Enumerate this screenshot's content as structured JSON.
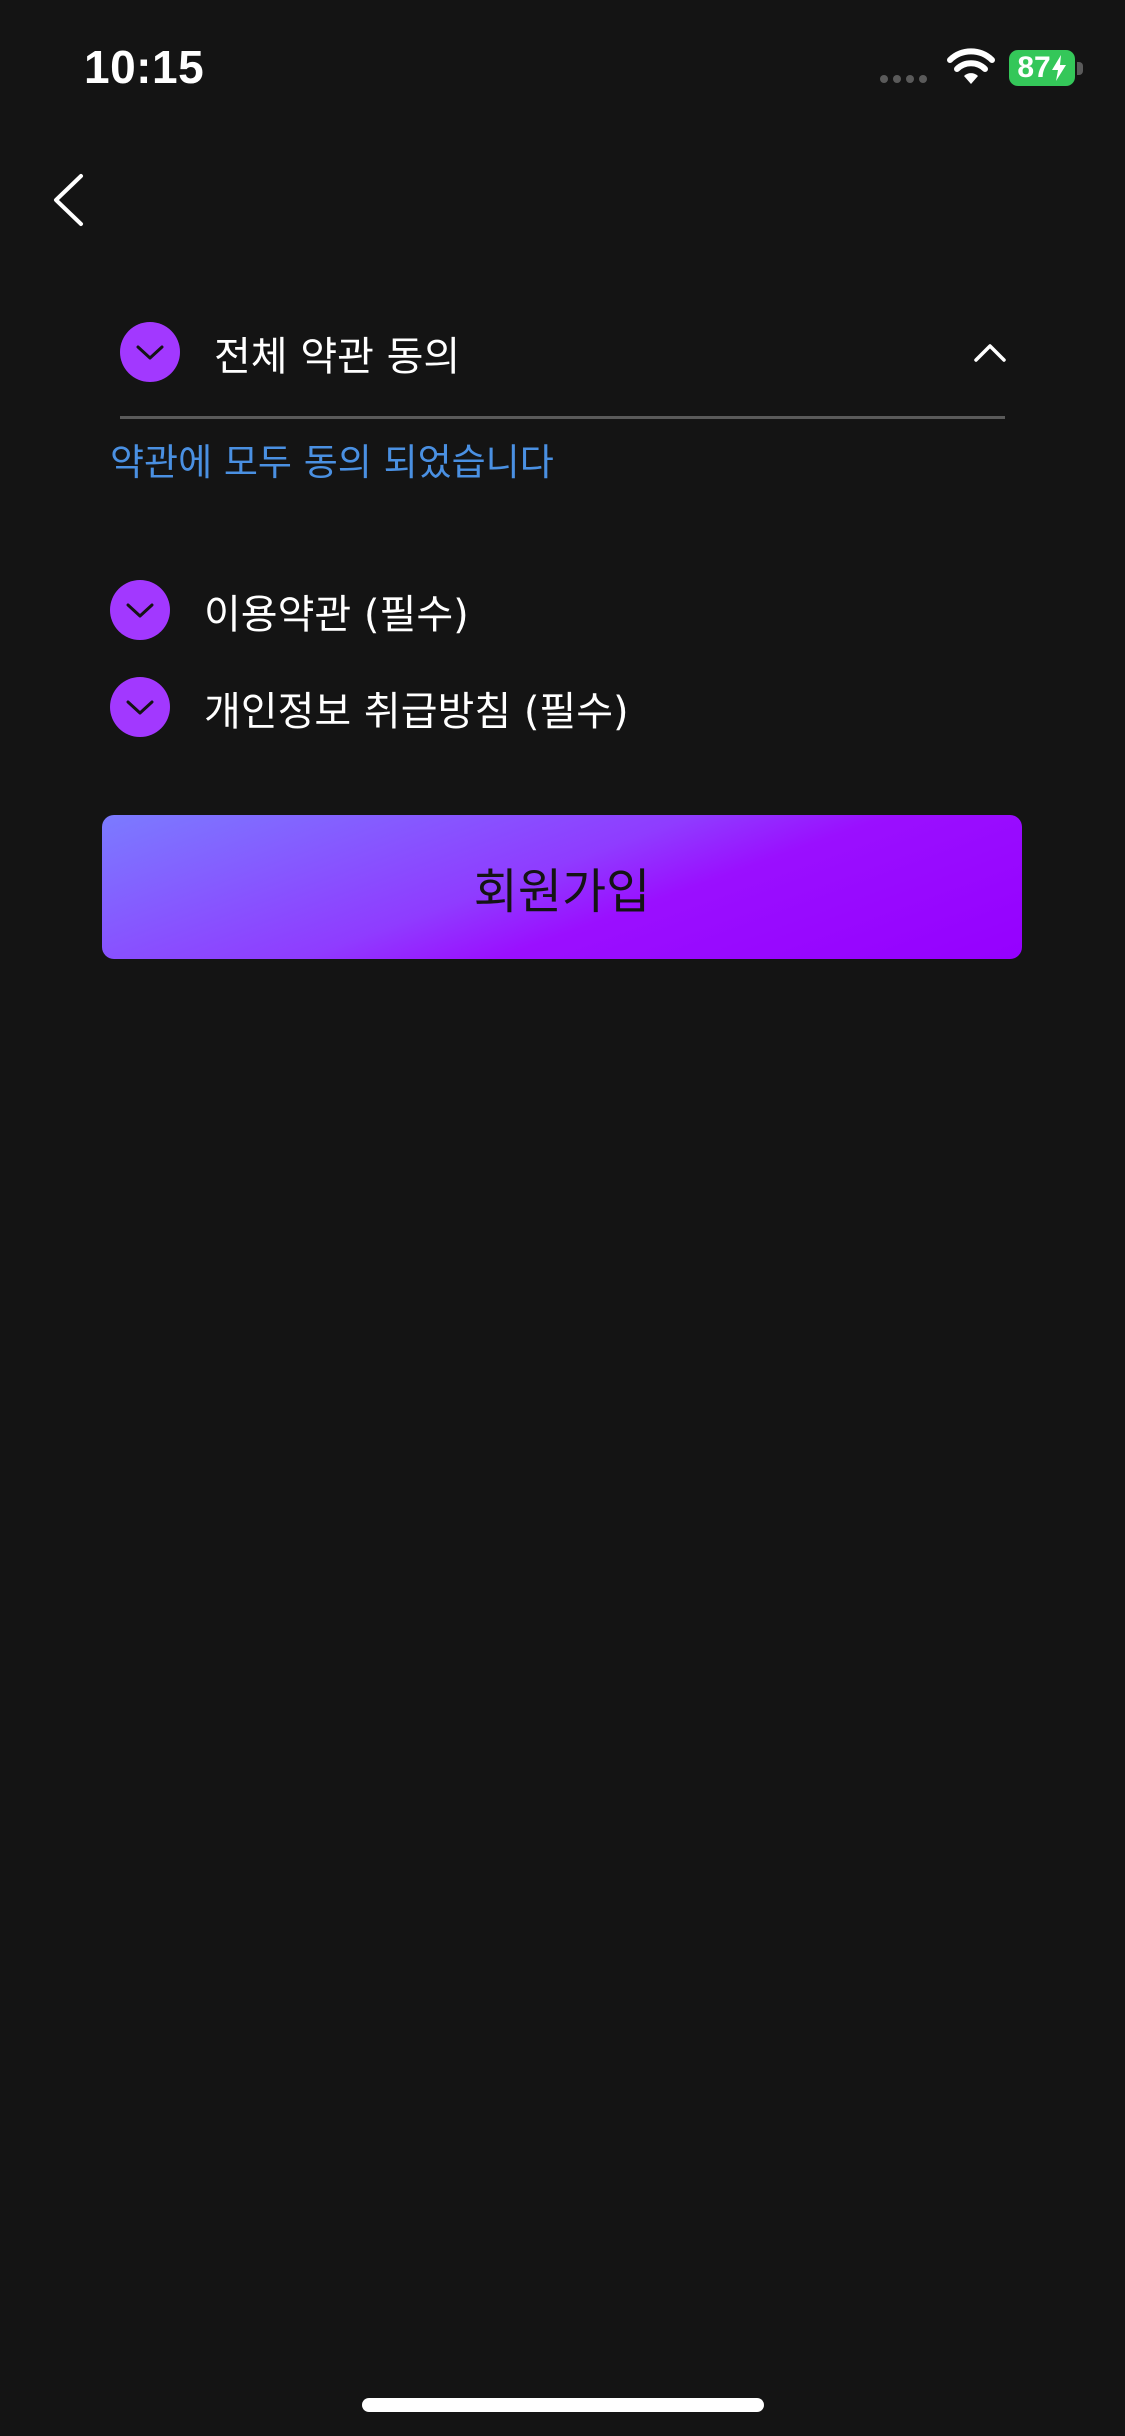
{
  "status_bar": {
    "time": "10:15",
    "battery": "87",
    "battery_color": "#34c759"
  },
  "nav": {
    "back_icon": "chevron-left-icon"
  },
  "agreement": {
    "all_agree_label": "전체 약관 동의",
    "all_agree_checked": true,
    "collapse_icon": "chevron-up-icon",
    "status_text": "약관에 모두 동의 되었습니다",
    "status_color": "#4a90e2",
    "items": [
      {
        "label": "이용약관 (필수)",
        "checked": true
      },
      {
        "label": "개인정보 취급방침 (필수)",
        "checked": true
      }
    ]
  },
  "signup": {
    "label": "회원가입"
  },
  "colors": {
    "background": "#141414",
    "accent": "#a238ff",
    "button_gradient_start": "#7b7bff",
    "button_gradient_end": "#9500ff"
  }
}
